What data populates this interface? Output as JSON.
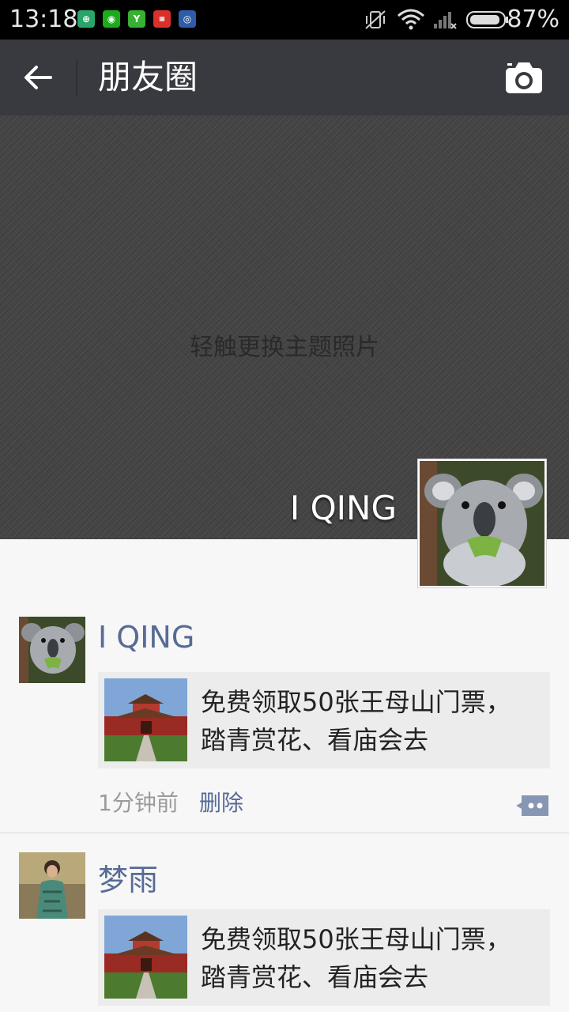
{
  "status_bar": {
    "time": "13:18",
    "battery_percent": "87%",
    "notification_icons": [
      "shield-app-icon",
      "wechat-icon",
      "green-app-icon",
      "red-app-icon",
      "blue-app-icon"
    ],
    "system_icons": [
      "mute-vibrate-icon",
      "wifi-icon",
      "signal-icon",
      "battery-icon"
    ]
  },
  "header": {
    "title": "朋友圈",
    "background": "#393a3f"
  },
  "cover": {
    "hint": "轻触更换主题照片",
    "user_name": "I QING"
  },
  "posts": [
    {
      "author": "I QING",
      "link_title": "免费领取50张王母山门票，踏青赏花、看庙会去",
      "time": "1分钟前",
      "delete_label": "删除"
    },
    {
      "author": "梦雨",
      "link_title": "免费领取50张王母山门票，踏青赏花、看庙会去"
    }
  ],
  "colors": {
    "link_blue": "#576b95",
    "page_bg": "#f7f7f7"
  }
}
